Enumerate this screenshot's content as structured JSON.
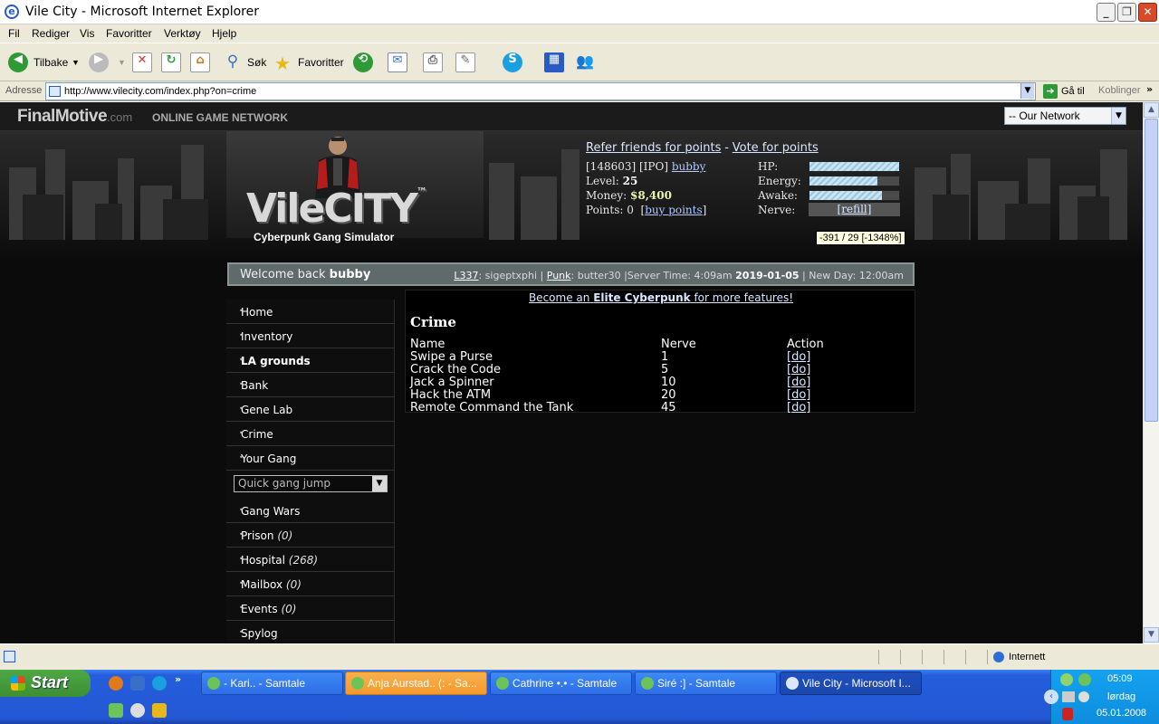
{
  "window": {
    "title": "Vile City - Microsoft Internet Explorer"
  },
  "menu": {
    "items": [
      "Fil",
      "Rediger",
      "Vis",
      "Favoritter",
      "Verktøy",
      "Hjelp"
    ]
  },
  "toolbar": {
    "back_label": "Tilbake",
    "search_label": "Søk",
    "favorites_label": "Favoritter"
  },
  "address": {
    "label": "Adresse",
    "url": "http://www.vilecity.com/index.php?on=crime",
    "go_label": "Gå til",
    "links_label": "Koblinger"
  },
  "network": {
    "logo": "FinalMotive",
    "logo_suffix": ".com",
    "name": "ONLINE GAME NETWORK",
    "select_value": "-- Our Network"
  },
  "header": {
    "logo": "VileCITY",
    "logo_tm": "™",
    "subtitle": "Cyberpunk Gang Simulator",
    "refer_link": "Refer friends for points",
    "separator": "-",
    "vote_link": "Vote for points"
  },
  "player": {
    "id": "[148603]",
    "tag": "[IPO]",
    "name": "bubby",
    "level_label": "Level:",
    "level": "25",
    "money_label": "Money:",
    "money": "$8,400",
    "points_label": "Points:",
    "points": "0",
    "buy_points": "buy points"
  },
  "meters": {
    "hp_label": "HP:",
    "hp": 1.0,
    "energy_label": "Energy:",
    "energy": 0.76,
    "awake_label": "Awake:",
    "awake": 0.81,
    "nerve_label": "Nerve:",
    "refill": "[refill]",
    "tooltip": "-391 / 29 [-1348%]"
  },
  "welcome": {
    "text": "Welcome back",
    "name": "bubby",
    "online1": "L337",
    "online1_user": ": sigeptxphi |",
    "online2": "Punk",
    "online2_user": ": butter30 |Server Time: 4:09am",
    "date": "2019-01-05",
    "newday": "| New Day: 12:00am"
  },
  "sidebar": {
    "items": [
      {
        "label": "Home"
      },
      {
        "label": "Inventory"
      },
      {
        "label": "LA grounds"
      },
      {
        "label": "Bank"
      },
      {
        "label": "Gene Lab"
      },
      {
        "label": "Crime"
      },
      {
        "label": "Your Gang"
      }
    ],
    "gang_jump": "Quick gang jump",
    "items2": [
      {
        "label": "Gang Wars",
        "count": ""
      },
      {
        "label": "Prison",
        "count": "(0)"
      },
      {
        "label": "Hospital",
        "count": "(268)"
      },
      {
        "label": "Mailbox",
        "count": "(0)"
      },
      {
        "label": "Events",
        "count": "(0)"
      },
      {
        "label": "Spylog",
        "count": ""
      }
    ]
  },
  "main": {
    "elite_pre": "Become an",
    "elite_bold": "Elite Cyberpunk",
    "elite_post": "for more features!",
    "title": "Crime",
    "columns": [
      "Name",
      "Nerve",
      "Action"
    ],
    "crimes": [
      {
        "name": "Swipe a Purse",
        "nerve": "1",
        "action": "[do]"
      },
      {
        "name": "Crack the Code",
        "nerve": "5",
        "action": "[do]"
      },
      {
        "name": "Jack a Spinner",
        "nerve": "10",
        "action": "[do]"
      },
      {
        "name": "Hack the ATM",
        "nerve": "20",
        "action": "[do]"
      },
      {
        "name": "Remote Command the Tank",
        "nerve": "45",
        "action": "[do]"
      }
    ]
  },
  "statusbar": {
    "zone": "Internett"
  },
  "taskbar": {
    "start": "Start",
    "tasks": [
      {
        "label": "- Kari.. - Samtale"
      },
      {
        "label": "Anja Aurstad.. (: - Sa..."
      },
      {
        "label": "Cathrine •.• - Samtale"
      },
      {
        "label": "Siré :] - Samtale"
      },
      {
        "label": "Vile City - Microsoft I..."
      }
    ],
    "time": "05:09",
    "day": "lørdag",
    "date": "05.01.2008"
  }
}
